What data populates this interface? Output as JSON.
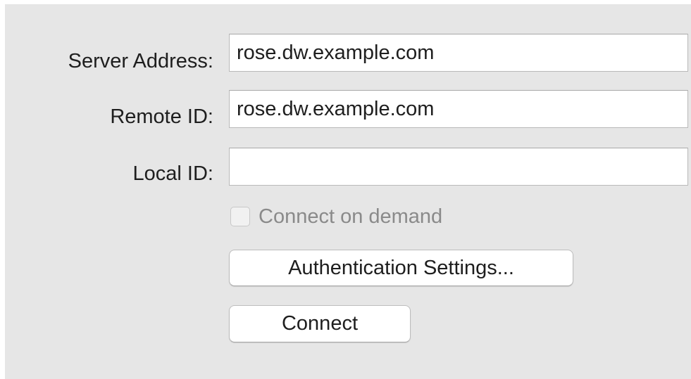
{
  "form": {
    "server_address": {
      "label": "Server Address:",
      "value": "rose.dw.example.com"
    },
    "remote_id": {
      "label": "Remote ID:",
      "value": "rose.dw.example.com"
    },
    "local_id": {
      "label": "Local ID:",
      "value": ""
    },
    "connect_on_demand": {
      "label": "Connect on demand",
      "checked": false,
      "enabled": false
    },
    "authentication_button": {
      "label": "Authentication Settings..."
    },
    "connect_button": {
      "label": "Connect"
    }
  },
  "colors": {
    "panel_background": "#e6e6e6",
    "field_background": "#ffffff",
    "disabled_text": "#8a8a8a"
  }
}
